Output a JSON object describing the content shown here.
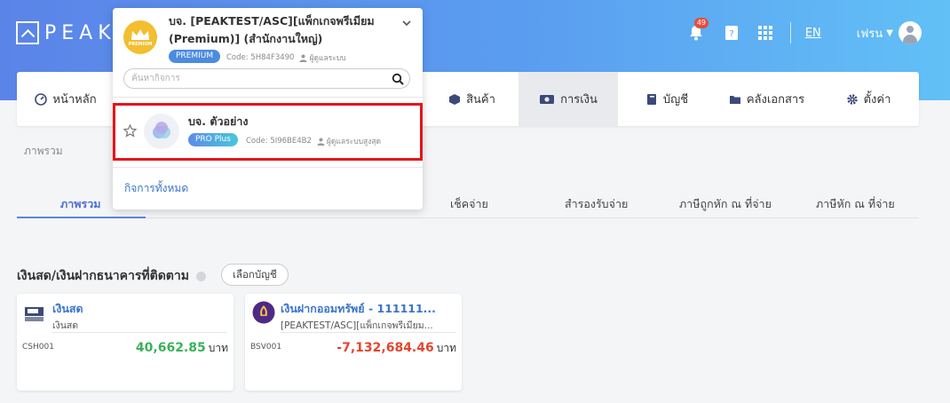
{
  "header": {
    "logo_text": "PEAK",
    "notification_count": "49",
    "language": "EN",
    "user_name": "เฟรน"
  },
  "nav": {
    "items": [
      {
        "label": "หน้าหลัก",
        "icon": "dashboard-icon"
      },
      {
        "label": "สินค้า",
        "icon": "box-icon"
      },
      {
        "label": "การเงิน",
        "icon": "money-icon"
      },
      {
        "label": "บัญชี",
        "icon": "ledger-icon"
      },
      {
        "label": "คลังเอกสาร",
        "icon": "folder-icon"
      },
      {
        "label": "ตั้งค่า",
        "icon": "gear-icon"
      }
    ]
  },
  "breadcrumb": "ภาพรวม",
  "tabs": [
    {
      "label": "ภาพรวม"
    },
    {
      "label": "เช็คจ่าย"
    },
    {
      "label": "สำรองรับจ่าย"
    },
    {
      "label": "ภาษีถูกหัก ณ ที่จ่าย"
    },
    {
      "label": "ภาษีหัก ณ ที่จ่าย"
    }
  ],
  "section": {
    "title": "เงินสด/เงินฝากธนาคารที่ติดตาม",
    "select_button": "เลือกบัญชี"
  },
  "cards": [
    {
      "name": "เงินสด",
      "sub": "เงินสด",
      "code": "CSH001",
      "amount": "40,662.85",
      "unit": "บาท",
      "amount_color": "#3ab25a"
    },
    {
      "name": "เงินฝากออมทรัพย์ - 111111...",
      "sub": "[PEAKTEST/ASC][แพ็กเกจพรีเมียม...",
      "code": "BSV001",
      "amount": "-7,132,684.46",
      "unit": "บาท",
      "amount_color": "#e2452f"
    }
  ],
  "dropdown": {
    "current_business": "บจ. [PEAKTEST/ASC][แพ็กเกจพรีเมียม (Premium)] (สำนักงานใหญ่)",
    "current_package": "PREMIUM",
    "current_code": "Code: 5H84F3490",
    "current_role": "ผู้ดูแลระบบ",
    "logo_word": "PREMIUM",
    "search_placeholder": "ค้นหากิจการ",
    "business_item": {
      "name": "บจ. ตัวอย่าง",
      "package": "PRO Plus",
      "code": "Code: 5I96BE4B2",
      "role": "ผู้ดูแลระบบสูงสุด"
    },
    "all_businesses_link": "กิจการทั้งหมด"
  }
}
